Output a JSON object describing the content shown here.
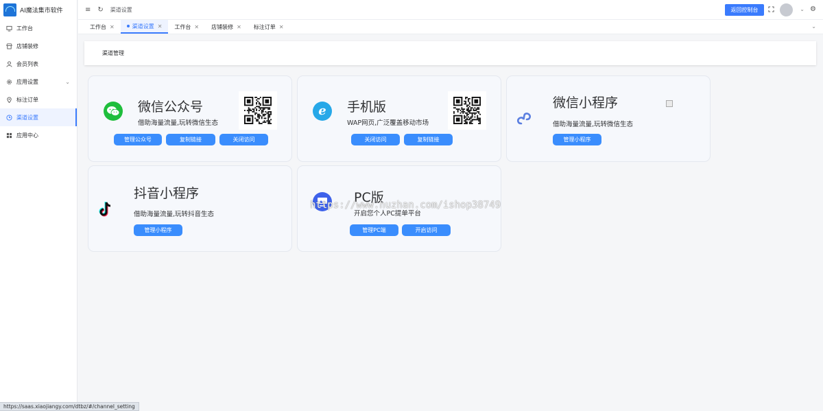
{
  "app": {
    "title": "AI魔法集市软件"
  },
  "sidebar": {
    "items": [
      {
        "label": "工作台",
        "icon": "monitor-icon"
      },
      {
        "label": "店铺装修",
        "icon": "store-icon"
      },
      {
        "label": "会员列表",
        "icon": "user-icon"
      },
      {
        "label": "应用设置",
        "icon": "settings-icon"
      },
      {
        "label": "标注订单",
        "icon": "location-icon"
      },
      {
        "label": "渠道设置",
        "icon": "clock-icon"
      },
      {
        "label": "应用中心",
        "icon": "grid-icon"
      }
    ],
    "active_index": 5
  },
  "header": {
    "breadcrumb": "渠道设置",
    "back_button": "返回控制台"
  },
  "tabs": [
    {
      "label": "工作台"
    },
    {
      "label": "渠道设置"
    },
    {
      "label": "工作台"
    },
    {
      "label": "店铺装修"
    },
    {
      "label": "标注订单"
    }
  ],
  "page": {
    "title": "渠道管理"
  },
  "channels": {
    "wechat_official": {
      "title": "微信公众号",
      "desc": "借助海量流量,玩转微信生态",
      "buttons": [
        "管理公众号",
        "复制链接",
        "关闭访问"
      ],
      "color": "#1fbe3c"
    },
    "mobile": {
      "title": "手机版",
      "desc": "WAP网页,广泛覆盖移动市场",
      "buttons": [
        "关闭访问",
        "复制链接"
      ],
      "color": "#27a8e8"
    },
    "wechat_mini": {
      "title": "微信小程序",
      "desc": "借助海量流量,玩转微信生态",
      "buttons": [
        "管理小程序"
      ],
      "color": "#5b7fe0"
    },
    "douyin_mini": {
      "title": "抖音小程序",
      "desc": "借助海量流量,玩转抖音生态",
      "buttons": [
        "管理小程序"
      ]
    },
    "pc": {
      "title": "PC版",
      "desc": "开启您个人PC提单平台",
      "buttons": [
        "管理PC端",
        "开启访问"
      ],
      "color": "#3e62ea"
    }
  },
  "statusbar": {
    "url": "https://saas.xiaojiangy.com/dtbz/#/channel_setting"
  },
  "watermark": "https://www.huzhan.com/ishop38749"
}
